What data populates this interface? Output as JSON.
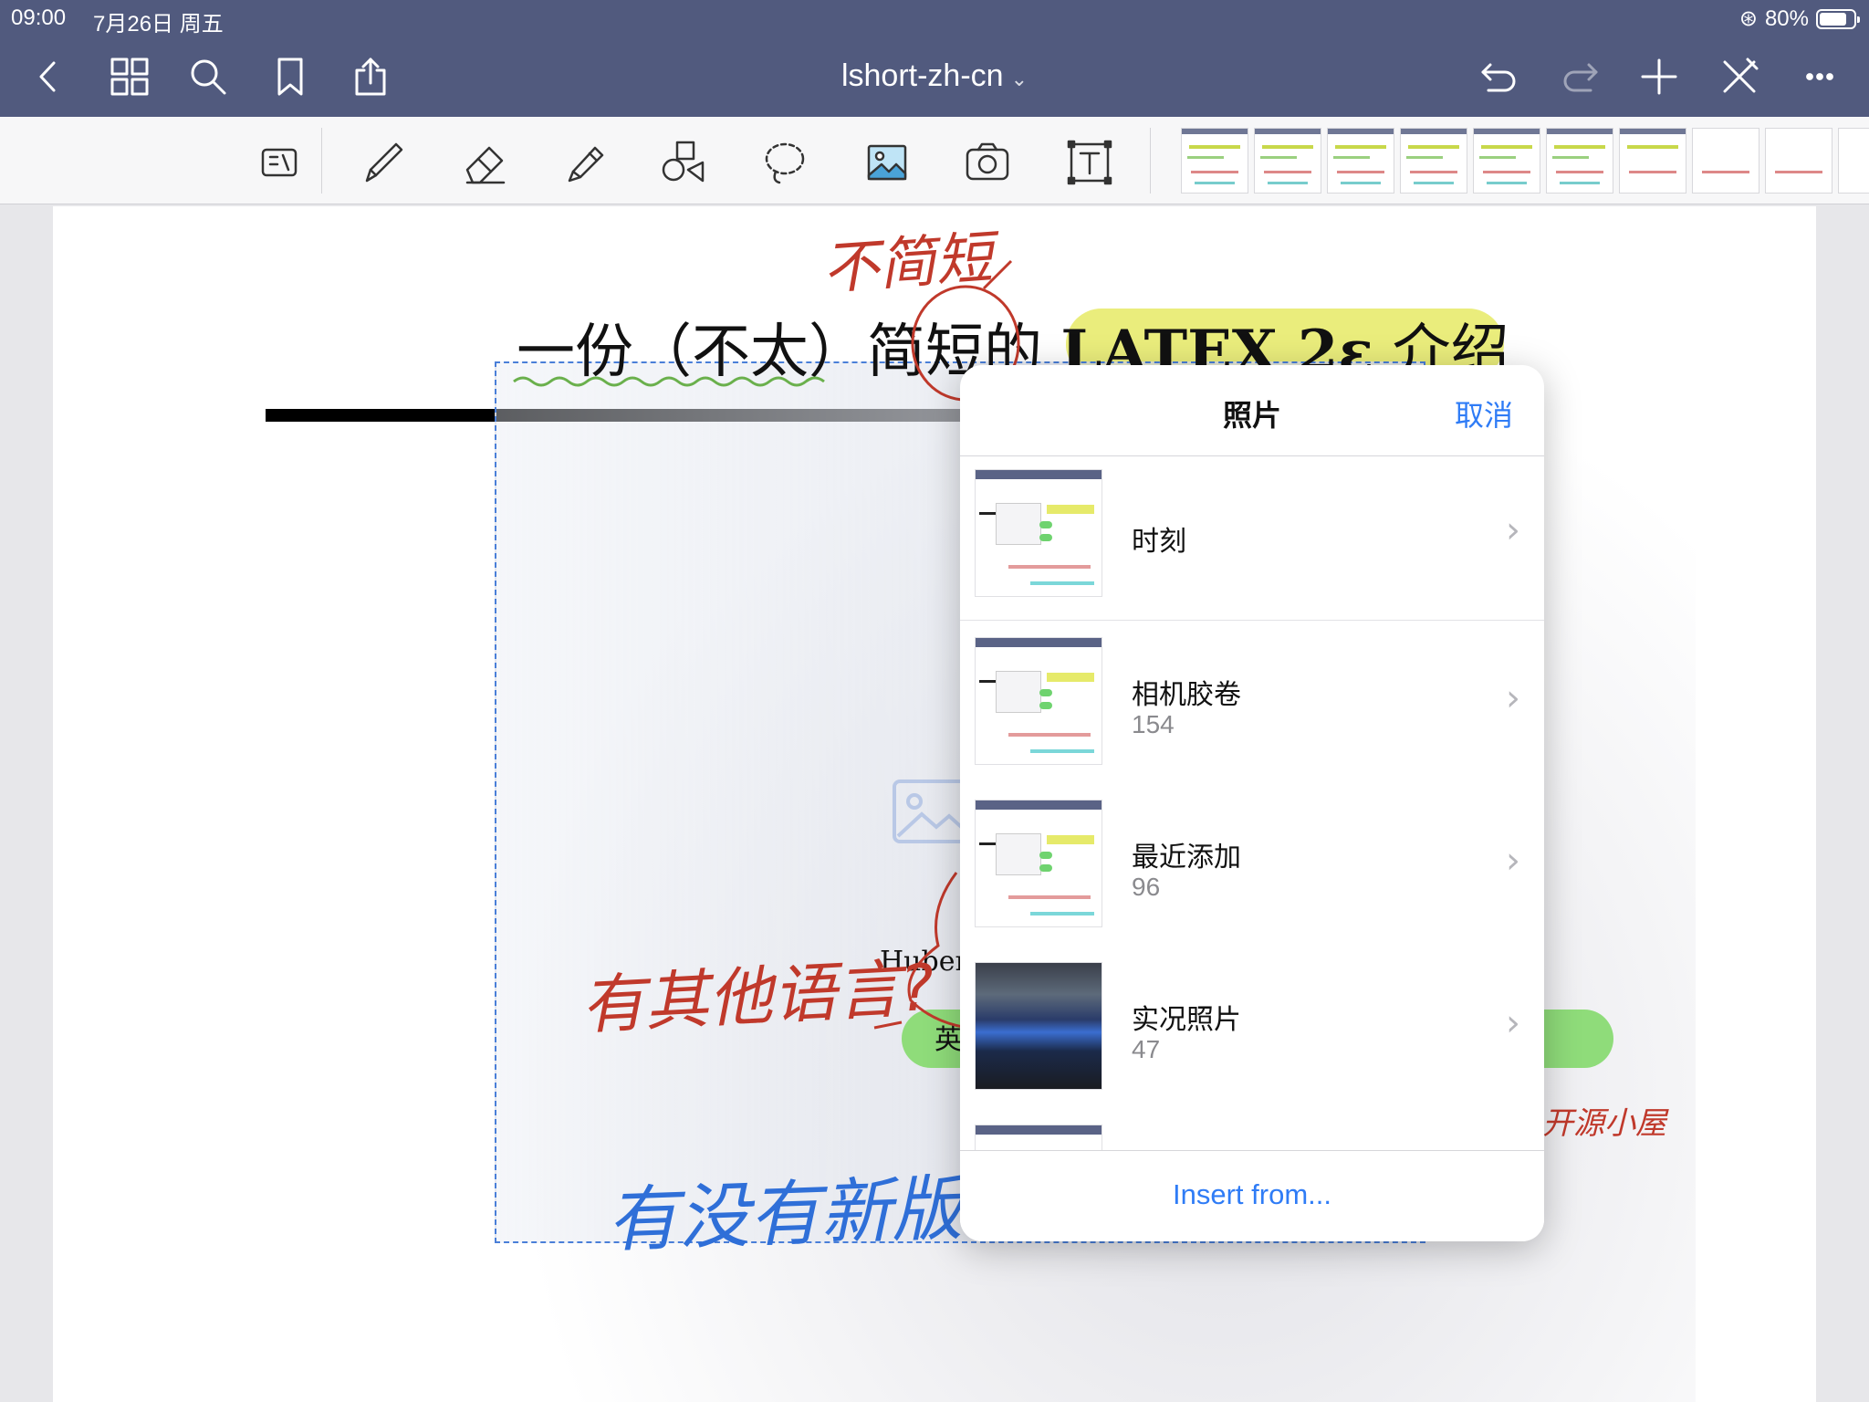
{
  "status": {
    "time": "09:00",
    "date": "7月26日 周五",
    "battery_percent": "80%",
    "battery_level": 0.8
  },
  "nav": {
    "document_title": "lshort-zh-cn",
    "left_icons": [
      "back-chevron-icon",
      "grid-icon",
      "search-icon",
      "bookmark-icon",
      "share-icon"
    ],
    "right_icons": [
      "undo-icon",
      "redo-icon",
      "add-icon",
      "close-x-icon",
      "more-icon"
    ]
  },
  "toolbar": {
    "tools": [
      "read-mode-icon",
      "pen-icon",
      "eraser-icon",
      "highlighter-icon",
      "shapes-icon",
      "lasso-icon",
      "image-icon",
      "camera-icon",
      "text-box-icon"
    ],
    "page_thumbnail_count": 10
  },
  "page": {
    "heading_part1": "一份（不太）简短的 ",
    "heading_latex": "LATEX 2ε",
    "heading_part2": " 介绍",
    "huber_text": "Huber",
    "green_char": "英",
    "ink": {
      "top_note": "不简短",
      "left_note": "有其他语言?",
      "right_note": "开源小屋",
      "bottom_note": "有没有新版本?"
    }
  },
  "popover": {
    "title": "照片",
    "cancel_label": "取消",
    "albums": [
      {
        "name": "时刻",
        "count": ""
      },
      {
        "name": "相机胶卷",
        "count": "154"
      },
      {
        "name": "最近添加",
        "count": "96"
      },
      {
        "name": "实况照片",
        "count": "47"
      }
    ],
    "footer_label": "Insert from..."
  },
  "colors": {
    "nav_bg": "#515a7e",
    "accent": "#2f7cf6",
    "ink_red": "#c0392b",
    "ink_blue": "#2f6fd8",
    "latex_highlight": "#eaed7c",
    "green_pill": "#8fdc7a",
    "cyan_pill": "#8fe3e5"
  }
}
